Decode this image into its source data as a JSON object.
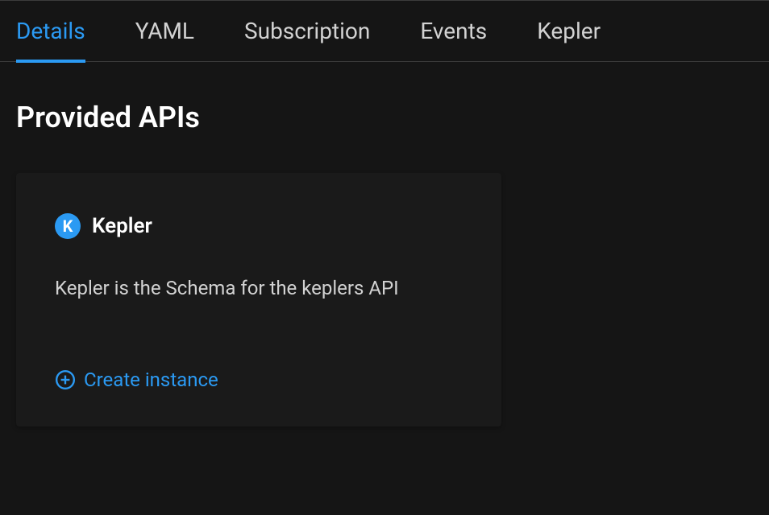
{
  "tabs": [
    {
      "label": "Details",
      "active": true
    },
    {
      "label": "YAML",
      "active": false
    },
    {
      "label": "Subscription",
      "active": false
    },
    {
      "label": "Events",
      "active": false
    },
    {
      "label": "Kepler",
      "active": false
    }
  ],
  "section": {
    "title": "Provided APIs"
  },
  "api_card": {
    "icon_letter": "K",
    "title": "Kepler",
    "description": "Kepler is the Schema for the keplers API",
    "create_label": "Create instance"
  },
  "colors": {
    "accent": "#2b9af3",
    "background": "#151515",
    "card_background": "#1a1a1a"
  }
}
